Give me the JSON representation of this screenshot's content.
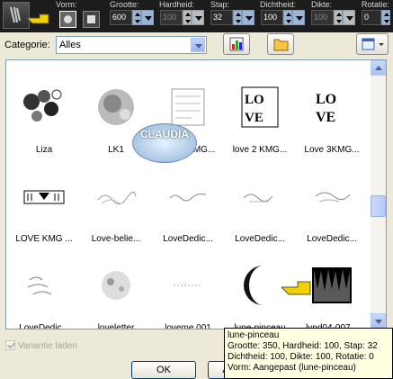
{
  "toolbar": {
    "shape_label": "Vorm:",
    "size_label": "Grootte:",
    "size_value": "600",
    "hardness_label": "Hardheid:",
    "hardness_value": "100",
    "step_label": "Stap:",
    "step_value": "32",
    "density_label": "Dichtheid:",
    "density_value": "100",
    "thickness_label": "Dikte:",
    "thickness_value": "100",
    "rotation_label": "Rotatie:",
    "rotation_value": "0"
  },
  "category": {
    "label": "Categorie:",
    "value": "Alles"
  },
  "watermark": {
    "text": "CLAUDIA"
  },
  "brushes": [
    {
      "name": "Liza"
    },
    {
      "name": "LK1"
    },
    {
      "name": "love 2 KMG..."
    },
    {
      "name": "love 2 KMG..."
    },
    {
      "name": "Love 3KMG..."
    },
    {
      "name": "LOVE KMG ..."
    },
    {
      "name": "Love-belie..."
    },
    {
      "name": "LoveDedic..."
    },
    {
      "name": "LoveDedic..."
    },
    {
      "name": "LoveDedic..."
    },
    {
      "name": "LoveDedic..."
    },
    {
      "name": "loveletter"
    },
    {
      "name": "loveme 001"
    },
    {
      "name": "lune-pinceau"
    },
    {
      "name": "lynd04-007..."
    }
  ],
  "variant_checkbox": {
    "label": "Variantie laden",
    "checked": true
  },
  "buttons": {
    "ok": "OK",
    "cancel": "A"
  },
  "tooltip": {
    "line1": "lune-pinceau",
    "line2": "Grootte: 350, Hardheid: 100, Stap: 32",
    "line3": "Dichtheid: 100, Dikte: 100, Rotatie: 0",
    "line4": "Vorm: Aangepast (lune-pinceau)"
  },
  "colors": {
    "toolbar_bg": "#1c1c1c",
    "dialog_bg": "#ece9d8",
    "tooltip_bg": "#ffffe1",
    "pointer_hand": "#f5d000"
  }
}
